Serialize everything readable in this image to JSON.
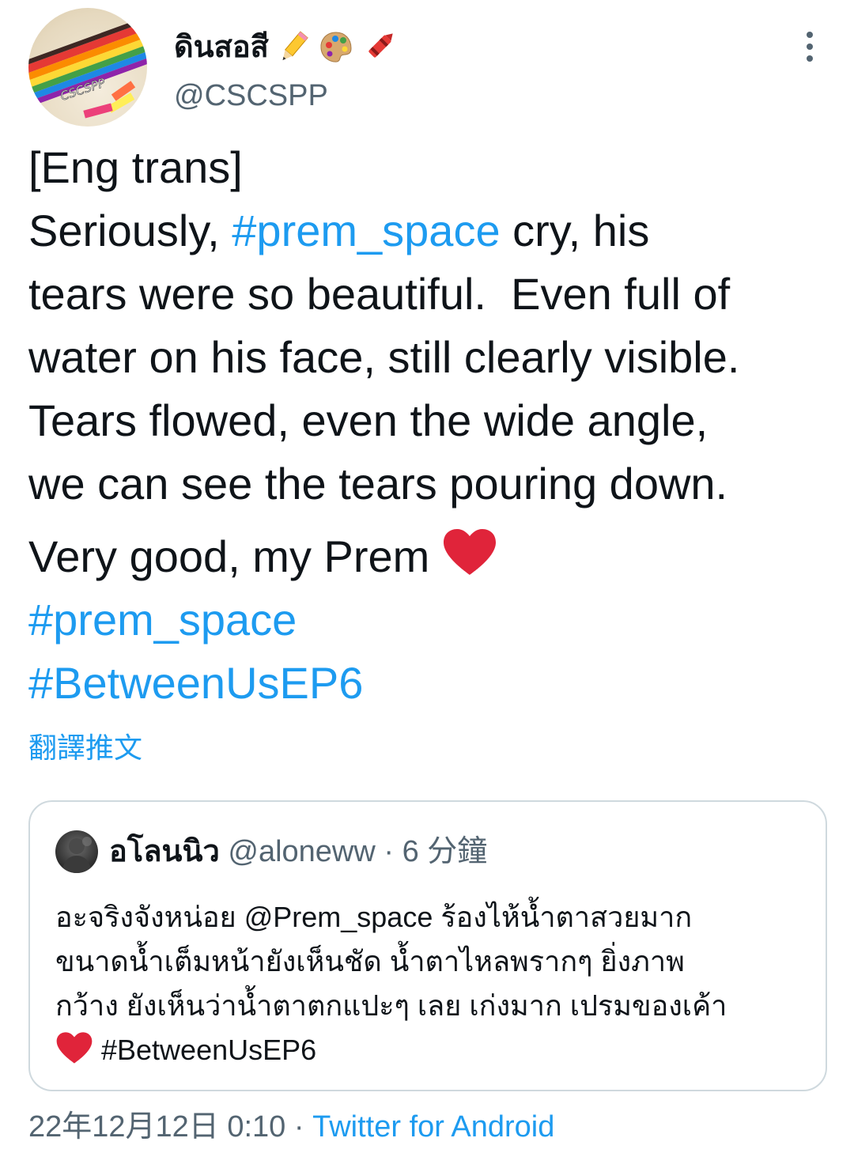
{
  "author": {
    "display_name": "ดินสอสี",
    "name_emojis": [
      "pencil-icon",
      "palette-icon",
      "crayon-icon"
    ],
    "handle": "@CSCSPP",
    "avatar_text": "CSCSPP"
  },
  "tweet": {
    "lines": [
      {
        "parts": [
          {
            "text": "[Eng trans]"
          }
        ]
      },
      {
        "parts": [
          {
            "text": "Seriously, "
          },
          {
            "text": "#prem_space",
            "link": true
          },
          {
            "text": " cry, his"
          }
        ]
      },
      {
        "parts": [
          {
            "text": "tears were so beautiful.  Even full of"
          }
        ]
      },
      {
        "parts": [
          {
            "text": "water on his face, still clearly visible."
          }
        ]
      },
      {
        "parts": [
          {
            "text": "Tears flowed, even the wide angle,"
          }
        ]
      },
      {
        "parts": [
          {
            "text": "we can see the tears pouring down."
          }
        ]
      }
    ],
    "closing": "Very good, my Prem ",
    "hashtags": [
      "#prem_space",
      "#BetweenUsEP6"
    ],
    "translate_label": "翻譯推文"
  },
  "quote": {
    "display_name": "อโลนนิว",
    "handle": "@aloneww",
    "separator": "·",
    "time": "6 分鐘",
    "lines": [
      "อะจริงจังหน่อย @Prem_space ร้องไห้น้ำตาสวยมาก",
      "ขนาดน้ำเต็มหน้ายังเห็นชัด น้ำตาไหลพรากๆ ยิ่งภาพ",
      "กว้าง ยังเห็นว่าน้ำตาตกแปะๆ เลย เก่งมาก เปรมของเค้า"
    ],
    "last_line": " #BetweenUsEP6"
  },
  "footer": {
    "timestamp": "22年12月12日 0:10",
    "separator": " · ",
    "source": "Twitter for Android"
  },
  "colors": {
    "link": "#1d9bf0",
    "secondary_text": "#536471",
    "heart": "#e0243a",
    "border": "#cfd9de"
  }
}
